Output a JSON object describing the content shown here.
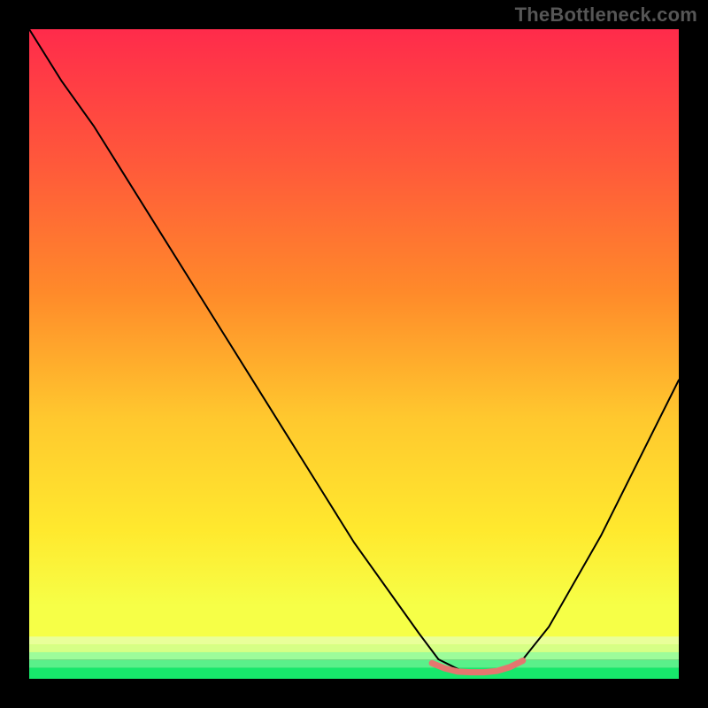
{
  "watermark": "TheBottleneck.com",
  "chart_data": {
    "type": "line",
    "title": "",
    "xlabel": "",
    "ylabel": "",
    "xlim": [
      0,
      100
    ],
    "ylim": [
      0,
      100
    ],
    "background_gradient": {
      "top": "#ff2b4b",
      "mid1": "#ff8a2a",
      "mid2": "#ffe92e",
      "low": "#f6ff47",
      "bottom_band_light": "#d6ff86",
      "bottom_band": "#17e86b"
    },
    "series": [
      {
        "name": "curve",
        "color": "#000000",
        "width": 2,
        "x": [
          0,
          5,
          10,
          15,
          20,
          25,
          30,
          35,
          40,
          45,
          50,
          55,
          60,
          63,
          67,
          72,
          76,
          80,
          84,
          88,
          92,
          96,
          100
        ],
        "y": [
          100,
          92,
          85,
          77,
          69,
          61,
          53,
          45,
          37,
          29,
          21,
          14,
          7,
          3,
          1,
          1,
          3,
          8,
          15,
          22,
          30,
          38,
          46
        ]
      },
      {
        "name": "highlight-segment",
        "color": "#e5766f",
        "width": 7,
        "x": [
          62,
          64,
          66,
          68,
          70,
          72,
          74,
          76
        ],
        "y": [
          2.4,
          1.6,
          1.1,
          1.0,
          1.0,
          1.2,
          1.8,
          2.8
        ]
      }
    ]
  }
}
